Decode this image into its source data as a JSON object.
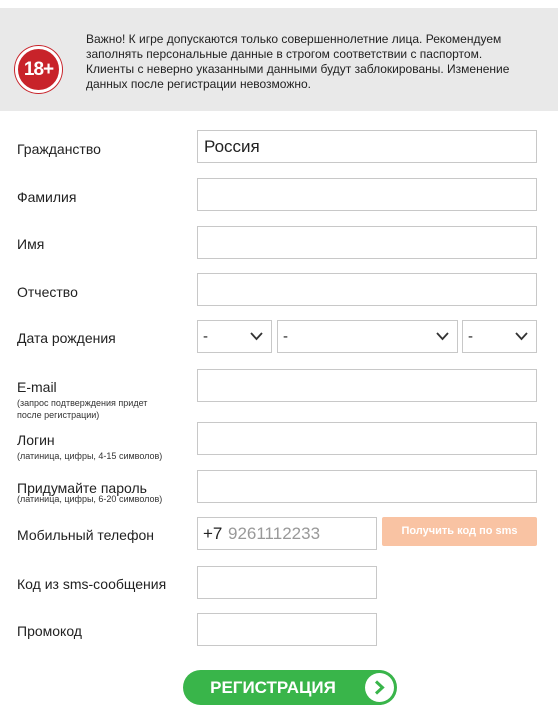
{
  "notice": {
    "badge": "18+",
    "line1": "Важно! К игре допускаются только совершеннолетние лица. Рекомендуем",
    "line2": "заполнять персональные данные в строгом соответствии с паспортом.",
    "line3": "Клиенты с неверно указанными данными будут заблокированы. Изменение",
    "line4": "данных после регистрации невозможно."
  },
  "form": {
    "citizenship": {
      "label": "Гражданство",
      "value": "Россия"
    },
    "surname": {
      "label": "Фамилия",
      "value": ""
    },
    "name": {
      "label": "Имя",
      "value": ""
    },
    "patronymic": {
      "label": "Отчество",
      "value": ""
    },
    "birthdate": {
      "label": "Дата рождения",
      "day": "-",
      "month": "-",
      "year": "-"
    },
    "email": {
      "label": "E-mail",
      "hint1": "(запрос подтверждения придет",
      "hint2": "после регистрации)",
      "value": ""
    },
    "login": {
      "label": "Логин",
      "hint": "(латиница, цифры, 4-15 символов)",
      "value": ""
    },
    "password": {
      "label": "Придумайте пароль",
      "hint": "(латиница, цифры, 6-20 символов)",
      "value": ""
    },
    "phone": {
      "label": "Мобильный телефон",
      "prefix": "+7",
      "placeholder": "9261112233"
    },
    "sms_button": "Получить код по sms",
    "sms_code": {
      "label": "Код из sms-сообщения",
      "value": ""
    },
    "promo": {
      "label": "Промокод",
      "value": ""
    }
  },
  "submit": {
    "label": "РЕГИСТРАЦИЯ",
    "icon": "chevron-right-icon"
  },
  "colors": {
    "badge": "#c8232a",
    "sms_button": "#f9c3a3",
    "submit": "#39b54a"
  }
}
